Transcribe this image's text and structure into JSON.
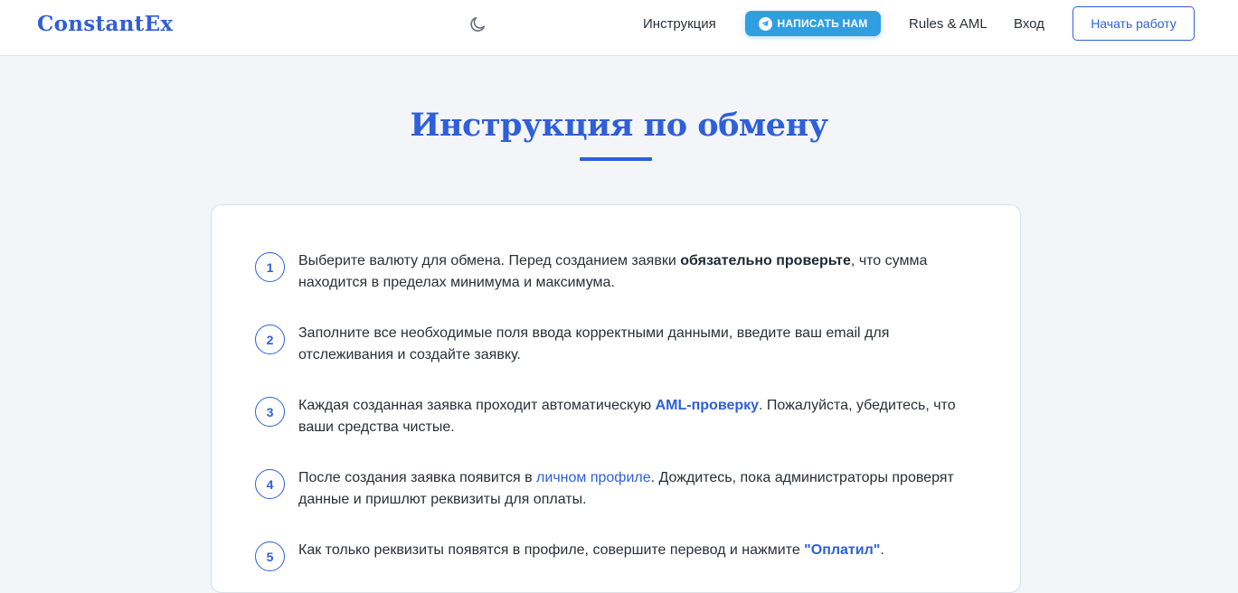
{
  "header": {
    "logo": "ConstantEx",
    "nav": {
      "instruction": "Инструкция",
      "telegram": "НАПИСАТЬ НАМ",
      "rules": "Rules & AML",
      "login": "Вход"
    },
    "start_button": "Начать работу"
  },
  "main": {
    "title": "Инструкция по обмену",
    "steps": [
      {
        "num": "1",
        "t1": "Выберите валюту для обмена. Перед созданием заявки ",
        "b1": "обязательно проверьте",
        "t2": ", что сумма находится в пределах минимума и максимума."
      },
      {
        "num": "2",
        "t1": "Заполните все необходимые поля ввода корректными данными, введите ваш email для отслеживания и создайте заявку."
      },
      {
        "num": "3",
        "t1": "Каждая созданная заявка проходит автоматическую ",
        "link": "AML-проверку",
        "t2": ". Пожалуйста, убедитесь, что ваши средства чистые."
      },
      {
        "num": "4",
        "t1": "После создания заявка появится в ",
        "link": "личном профиле",
        "t2": ". Дождитесь, пока администраторы проверят данные и пришлют реквизиты для оплаты."
      },
      {
        "num": "5",
        "t1": "Как только реквизиты появятся в профиле, совершите перевод и нажмите ",
        "link": "\"Оплатил\"",
        "t2": "."
      }
    ]
  },
  "colors": {
    "accent": "#2f5fd9",
    "telegram": "#2f9fe0",
    "background": "#f3f5f9"
  },
  "icons": {
    "theme_toggle": "moon-icon",
    "telegram": "telegram-icon"
  }
}
